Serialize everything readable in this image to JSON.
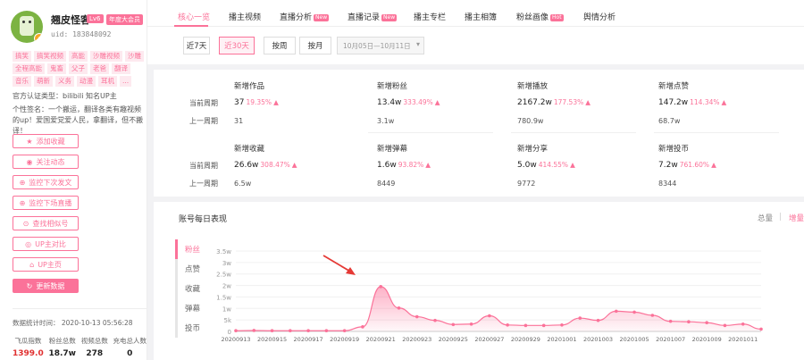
{
  "profile": {
    "name": "翘皮怪客",
    "level_badge": "Lv6",
    "vip_badge": "年度大会员",
    "uid": "uid: 183848092",
    "tags": [
      "搞笑",
      "搞笑视频",
      "高能",
      "沙雕视频",
      "沙雕",
      "全程高能",
      "鬼畜",
      "父子",
      "老爸",
      "翻译",
      "音乐",
      "萌新",
      "义务",
      "动漫",
      "耳机",
      "..."
    ],
    "official": "官方认证类型：bilibili 知名UP主",
    "signature": "个性签名：一个搬运，翻译各类有趣视频的up！爱国爱党爱人民，拿翻译，但不搬译！",
    "buttons": [
      {
        "icon": "★",
        "label": "添加收藏"
      },
      {
        "icon": "◉",
        "label": "关注动态"
      },
      {
        "icon": "⊕",
        "label": "监控下次发文"
      },
      {
        "icon": "⊕",
        "label": "监控下场直播"
      },
      {
        "icon": "⊙",
        "label": "查找相似号"
      },
      {
        "icon": "◎",
        "label": "UP主对比"
      },
      {
        "icon": "⌂",
        "label": "UP主页"
      },
      {
        "icon": "↻",
        "label": "更新数据"
      }
    ],
    "stat_time": "数据统计时间： 2020-10-13 05:56:28",
    "stats": [
      {
        "label": "飞瓜指数",
        "value": "1399.0"
      },
      {
        "label": "粉丝总数",
        "value": "18.7w"
      },
      {
        "label": "视频总数",
        "value": "278"
      },
      {
        "label": "充电总人数",
        "value": "0"
      }
    ]
  },
  "tabs": [
    {
      "label": "核心一览",
      "badge": ""
    },
    {
      "label": "播主视频",
      "badge": ""
    },
    {
      "label": "直播分析",
      "badge": "New"
    },
    {
      "label": "直播记录",
      "badge": "New"
    },
    {
      "label": "播主专栏",
      "badge": ""
    },
    {
      "label": "播主相簿",
      "badge": ""
    },
    {
      "label": "粉丝画像",
      "badge": "Hot"
    },
    {
      "label": "舆情分析",
      "badge": ""
    }
  ],
  "filters": {
    "range": [
      "近7天",
      "近30天"
    ],
    "period": [
      "按周",
      "按月"
    ],
    "date_range": "10月05日—10月11日"
  },
  "kpi": {
    "current_label": "当前周期",
    "prev_label": "上一周期",
    "cells": [
      {
        "title": "新增作品",
        "value": "37",
        "change": "19.35%",
        "prev": "31"
      },
      {
        "title": "新增粉丝",
        "value": "13.4w",
        "change": "333.49%",
        "prev": "3.1w"
      },
      {
        "title": "新增播放",
        "value": "2167.2w",
        "change": "177.53%",
        "prev": "780.9w"
      },
      {
        "title": "新增点赞",
        "value": "147.2w",
        "change": "114.34%",
        "prev": "68.7w"
      },
      {
        "title": "新增收藏",
        "value": "26.6w",
        "change": "308.47%",
        "prev": "6.5w"
      },
      {
        "title": "新增弹幕",
        "value": "1.6w",
        "change": "93.82%",
        "prev": "8449"
      },
      {
        "title": "新增分享",
        "value": "5.0w",
        "change": "414.55%",
        "prev": "9772"
      },
      {
        "title": "新增投币",
        "value": "7.2w",
        "change": "761.60%",
        "prev": "8344"
      }
    ]
  },
  "chart_section": {
    "title": "账号每日表现",
    "toggle_total": "总量",
    "toggle_sep": "|",
    "toggle_incr": "增量",
    "metrics": [
      "粉丝",
      "点赞",
      "收藏",
      "弹幕",
      "投币"
    ]
  },
  "colors": {
    "accent": "#fb7299"
  },
  "chart_data": {
    "type": "area",
    "x": [
      "20200913",
      "20200914",
      "20200915",
      "20200916",
      "20200917",
      "20200918",
      "20200919",
      "20200920",
      "20200921",
      "20200922",
      "20200923",
      "20200924",
      "20200925",
      "20200926",
      "20200927",
      "20200928",
      "20200929",
      "20200930",
      "20201001",
      "20201002",
      "20201003",
      "20201004",
      "20201005",
      "20201006",
      "20201007",
      "20201008",
      "20201009",
      "20201010",
      "20201011",
      "20201012"
    ],
    "xticks": [
      "20200913",
      "20200915",
      "20200917",
      "20200919",
      "20200921",
      "20200923",
      "20200925",
      "20200927",
      "20200929",
      "20201001",
      "20201003",
      "20201005",
      "20201007",
      "20201009",
      "20201011"
    ],
    "yticks": [
      "0",
      "5k",
      "1w",
      "1.5w",
      "2w",
      "2.5w",
      "3w",
      "3.5w"
    ],
    "ylim": [
      0,
      35000
    ],
    "values": [
      300,
      400,
      300,
      300,
      300,
      300,
      300,
      2000,
      19500,
      10200,
      6400,
      4800,
      3000,
      3200,
      6800,
      2800,
      2600,
      2600,
      2800,
      5800,
      4800,
      8800,
      8400,
      7000,
      4400,
      4200,
      3800,
      2600,
      3200,
      1000
    ]
  }
}
